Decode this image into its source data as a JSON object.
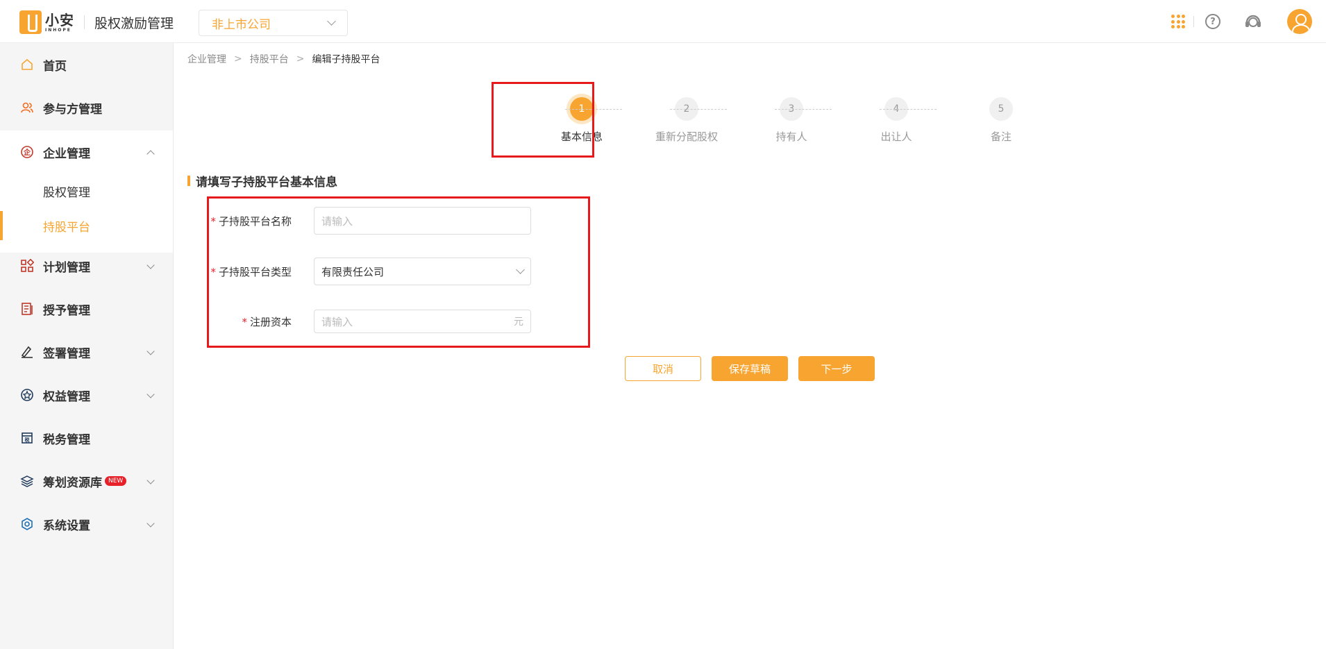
{
  "header": {
    "logo_cn": "小安",
    "logo_en": "INHOPE",
    "app_title": "股权激励管理",
    "company_select": "非上市公司"
  },
  "sidebar": {
    "items": [
      {
        "label": "首页",
        "icon": "home-icon"
      },
      {
        "label": "参与方管理",
        "icon": "users-icon"
      },
      {
        "label": "企业管理",
        "icon": "enterprise-icon",
        "expanded": true
      },
      {
        "label": "计划管理",
        "icon": "plan-icon"
      },
      {
        "label": "授予管理",
        "icon": "grant-icon"
      },
      {
        "label": "签署管理",
        "icon": "sign-icon"
      },
      {
        "label": "权益管理",
        "icon": "equity-icon"
      },
      {
        "label": "税务管理",
        "icon": "tax-icon"
      },
      {
        "label": "筹划资源库",
        "icon": "layers-icon",
        "badge": "NEW"
      },
      {
        "label": "系统设置",
        "icon": "settings-icon"
      }
    ],
    "sub_items": [
      {
        "label": "股权管理",
        "active": false
      },
      {
        "label": "持股平台",
        "active": true
      }
    ]
  },
  "breadcrumb": [
    "企业管理",
    "持股平台",
    "编辑子持股平台"
  ],
  "steps": [
    {
      "num": "1",
      "label": "基本信息",
      "active": true
    },
    {
      "num": "2",
      "label": "重新分配股权",
      "active": false
    },
    {
      "num": "3",
      "label": "持有人",
      "active": false
    },
    {
      "num": "4",
      "label": "出让人",
      "active": false
    },
    {
      "num": "5",
      "label": "备注",
      "active": false
    }
  ],
  "section_title": "请填写子持股平台基本信息",
  "form": {
    "name_label": "子持股平台名称",
    "name_placeholder": "请输入",
    "type_label": "子持股平台类型",
    "type_value": "有限责任公司",
    "capital_label": "注册资本",
    "capital_placeholder": "请输入",
    "capital_suffix": "元",
    "required_mark": "*"
  },
  "buttons": {
    "cancel": "取消",
    "save_draft": "保存草稿",
    "next": "下一步"
  },
  "colors": {
    "accent": "#f7a530",
    "highlight_box": "#e61a1a",
    "badge": "#e6212a"
  }
}
